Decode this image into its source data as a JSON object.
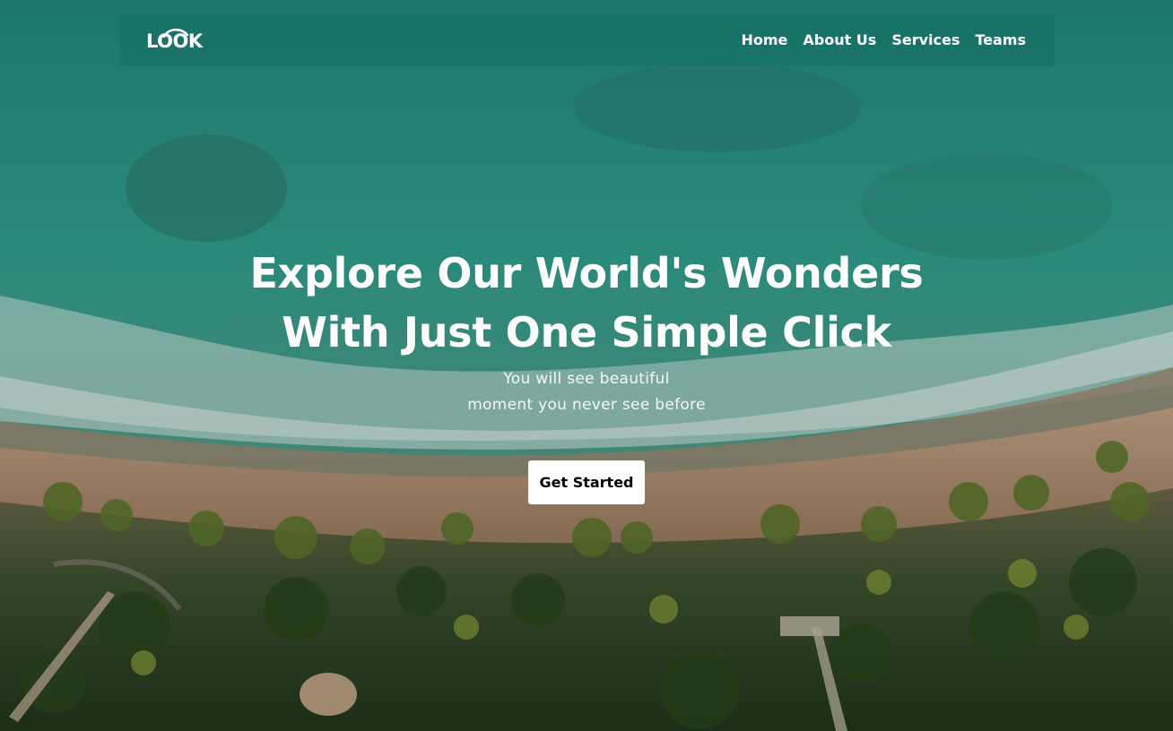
{
  "brand": {
    "logo_text": "LOOK"
  },
  "nav": {
    "items": [
      {
        "label": "Home"
      },
      {
        "label": "About Us"
      },
      {
        "label": "Services"
      },
      {
        "label": "Teams"
      }
    ]
  },
  "hero": {
    "headline_line1": "Explore Our World's Wonders",
    "headline_line2": "With Just One Simple Click",
    "subtitle_line1": "You will see beautiful",
    "subtitle_line2": "moment you never see before",
    "cta_label": "Get Started"
  },
  "colors": {
    "sea": "#2f8a7e",
    "sand": "#b9957a",
    "foliage": "#3e5a2c",
    "button_bg": "#ffffff",
    "button_text": "#000000",
    "text": "#ffffff"
  }
}
